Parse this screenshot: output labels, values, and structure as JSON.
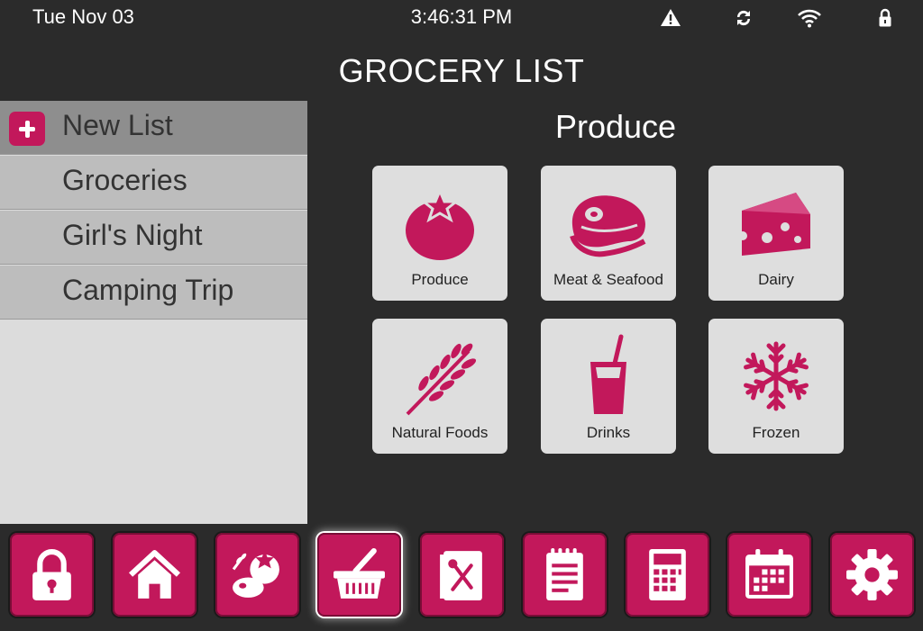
{
  "status": {
    "date": "Tue Nov 03",
    "time": "3:46:31 PM",
    "icons": [
      "warning-icon",
      "sync-icon",
      "wifi-icon",
      "lock-icon"
    ]
  },
  "app": {
    "title": "GROCERY LIST"
  },
  "sidebar": {
    "items": [
      {
        "label": "New List",
        "icon": "plus-icon"
      },
      {
        "label": "Groceries"
      },
      {
        "label": "Girl's Night"
      },
      {
        "label": "Camping Trip"
      }
    ]
  },
  "main": {
    "heading": "Produce",
    "categories": [
      {
        "label": "Produce",
        "icon": "tomato-icon"
      },
      {
        "label": "Meat & Seafood",
        "icon": "steak-icon"
      },
      {
        "label": "Dairy",
        "icon": "cheese-icon"
      },
      {
        "label": "Natural Foods",
        "icon": "wheat-icon"
      },
      {
        "label": "Drinks",
        "icon": "drink-cup-icon"
      },
      {
        "label": "Frozen",
        "icon": "snowflake-icon"
      }
    ]
  },
  "dock": {
    "buttons": [
      {
        "icon": "padlock-icon"
      },
      {
        "icon": "home-icon"
      },
      {
        "icon": "food-groups-icon"
      },
      {
        "icon": "basket-icon"
      },
      {
        "icon": "recipe-book-icon"
      },
      {
        "icon": "notepad-icon"
      },
      {
        "icon": "calculator-icon"
      },
      {
        "icon": "calendar-icon"
      },
      {
        "icon": "settings-gear-icon"
      }
    ]
  },
  "colors": {
    "accent": "#c2185b",
    "background": "#2b2b2b",
    "sidebar": "#dcdcdc",
    "list_item": "#bdbdbd",
    "list_item_active": "#8e8e8e",
    "tile": "#dedede"
  }
}
